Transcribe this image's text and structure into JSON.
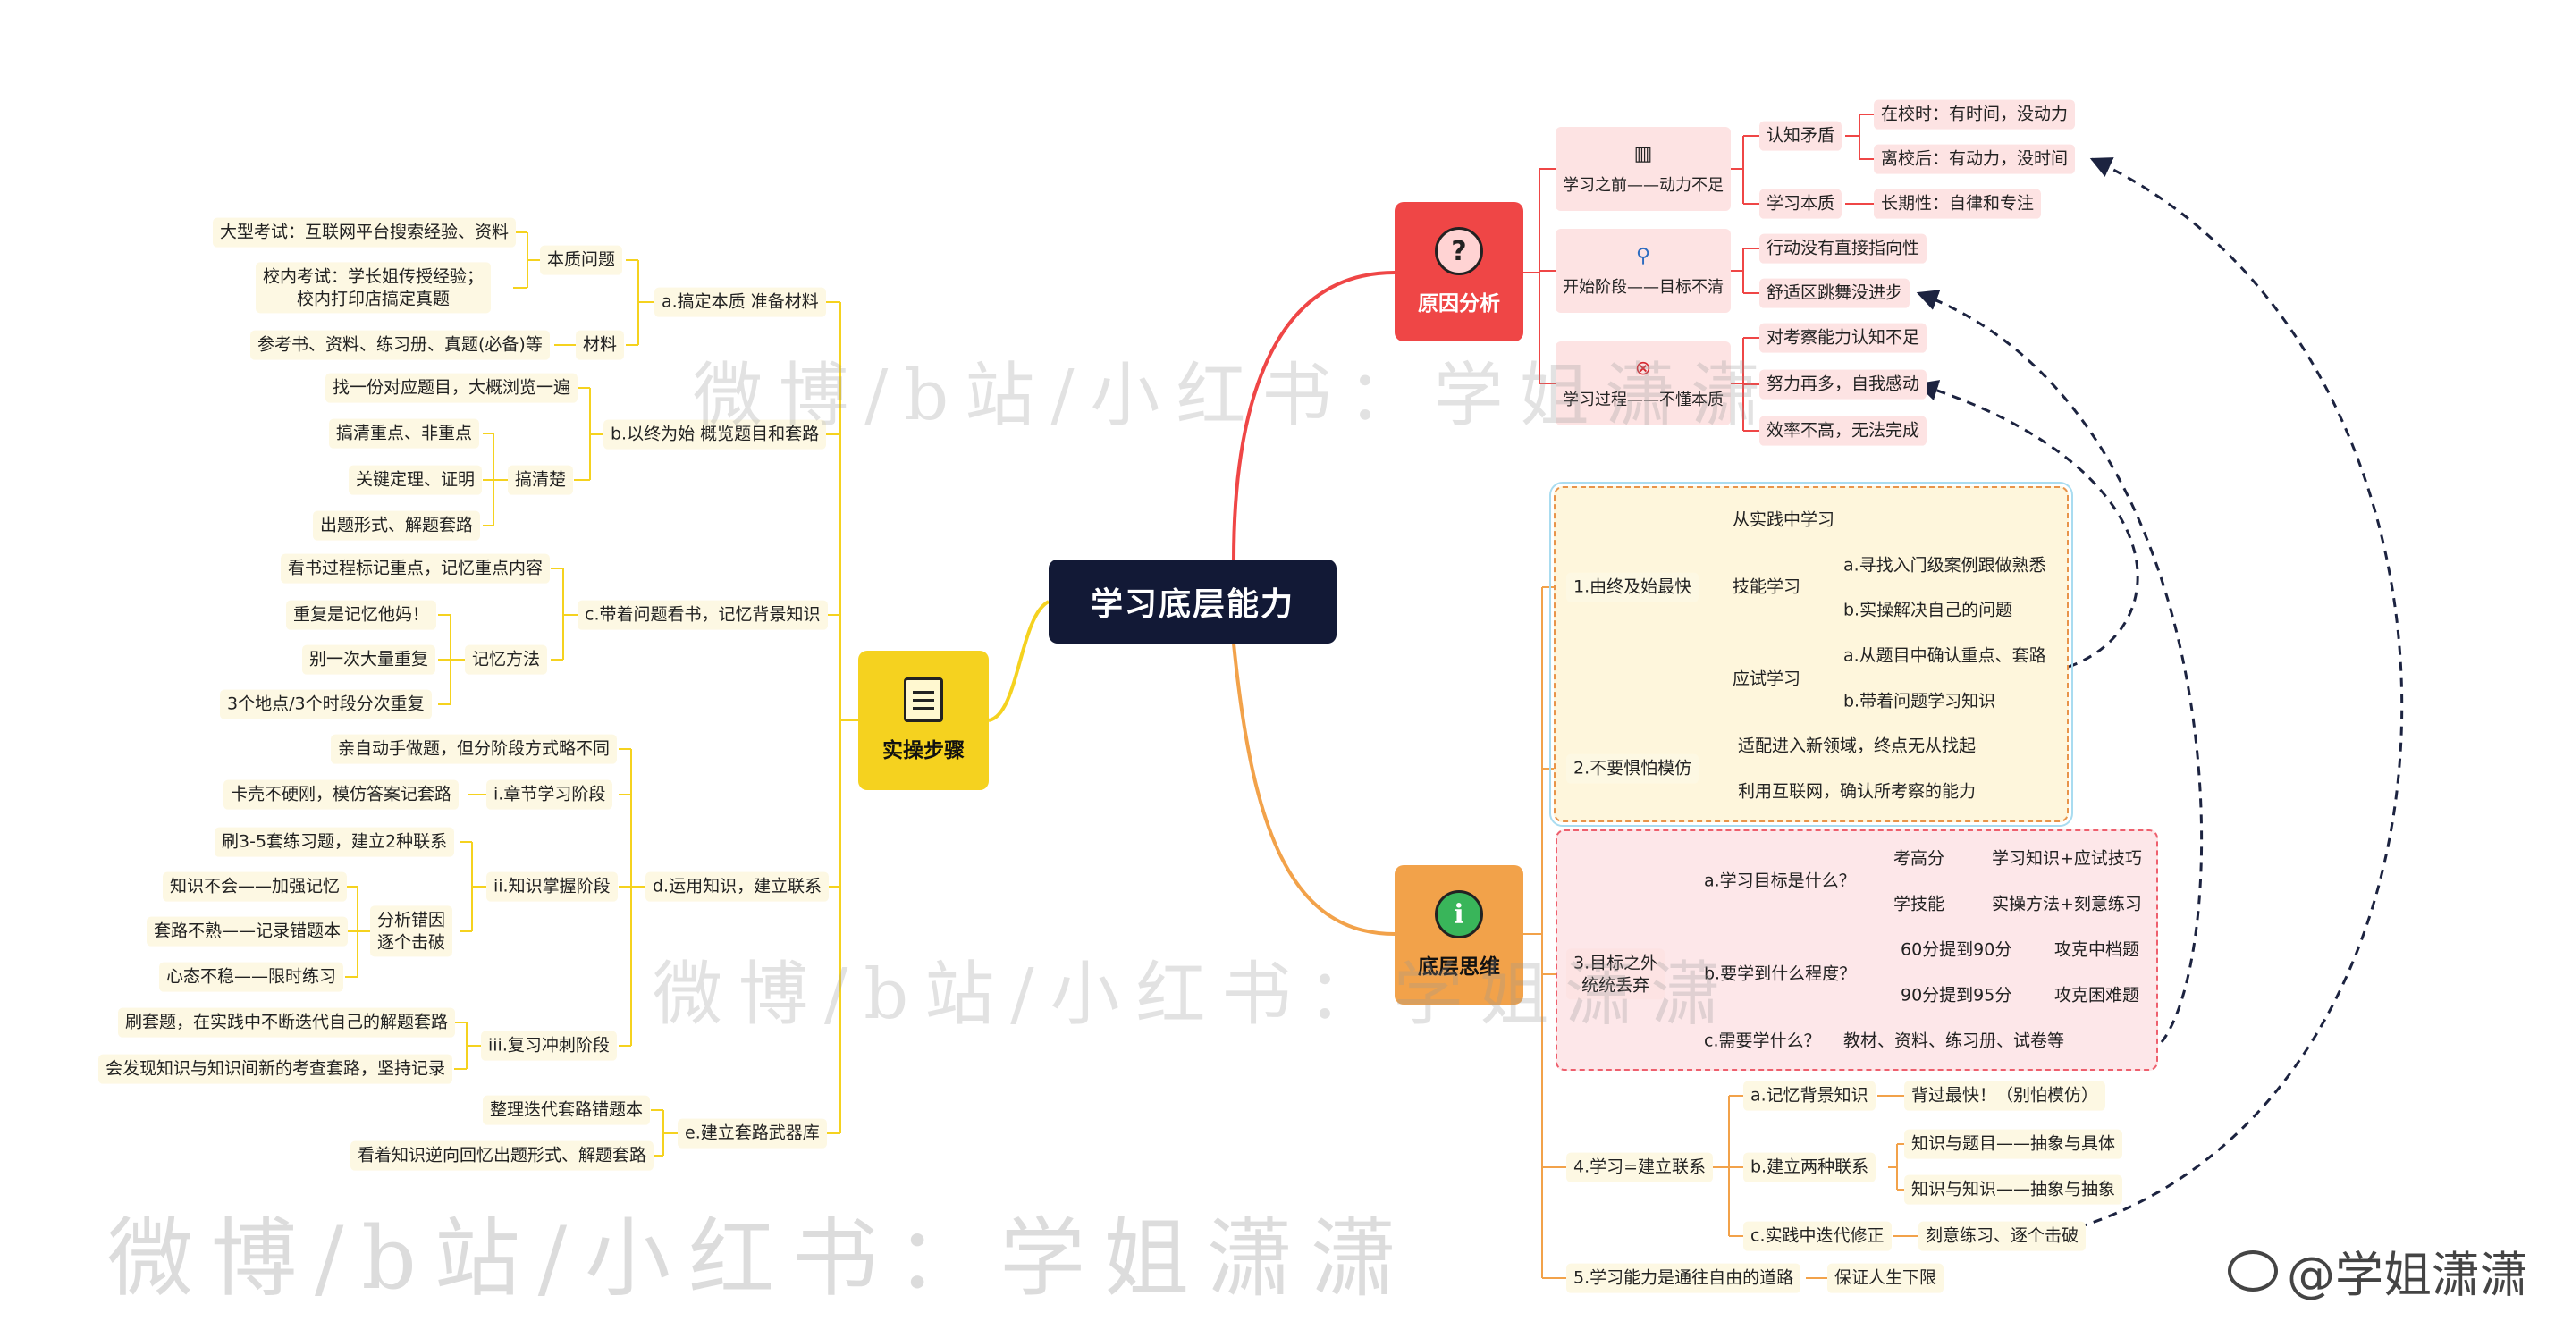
{
  "root": {
    "label": "学习底层能力"
  },
  "colors": {
    "root": "#121936",
    "cause": "#ef4646",
    "thinking": "#f2a24a",
    "steps": "#f5d21f",
    "light_red": "#fde3e3",
    "light_yellow": "#fdf8e3"
  },
  "cause": {
    "label": "原因分析",
    "icon": "question-icon",
    "before": {
      "label": "学习之前——动力不足",
      "icon": "bar-chart-icon",
      "cognitive": {
        "label": "认知矛盾",
        "school": "在校时：有时间，没动力",
        "off_school": "离校后：有动力，没时间"
      },
      "essence": {
        "label": "学习本质",
        "long_term": "长期性：自律和专注"
      }
    },
    "start": {
      "label": "开始阶段——目标不清",
      "icon": "magnifier-icon",
      "no_direction": "行动没有直接指向性",
      "comfort_zone": "舒适区跳舞没进步"
    },
    "process": {
      "label": "学习过程——不懂本质",
      "icon": "close-icon",
      "unaware": "对考察能力认知不足",
      "self_moved": "努力再多，自我感动",
      "low_efficiency": "效率不高，无法完成"
    }
  },
  "thinking": {
    "label": "底层思维",
    "icon": "info-icon",
    "p1": {
      "label": "1.由终及始最快",
      "practice": "从实践中学习",
      "skill": {
        "label": "技能学习",
        "a": "a.寻找入门级案例跟做熟悉",
        "b": "b.实操解决自己的问题"
      },
      "exam": {
        "label": "应试学习",
        "a": "a.从题目中确认重点、套路",
        "b": "b.带着问题学习知识"
      }
    },
    "p2": {
      "label": "2.不要惧怕模仿",
      "new_field": "适配进入新领域，终点无从找起",
      "internet": "利用互联网，确认所考察的能力"
    },
    "p3": {
      "label": "3.目标之外\n统统丢弃",
      "goal": {
        "label": "a.学习目标是什么？",
        "high_score": "考高分",
        "high_score_v": "学习知识+应试技巧",
        "learn_skill": "学技能",
        "learn_skill_v": "实操方法+刻意练习"
      },
      "degree": {
        "label": "b.要学到什么程度？",
        "to90": "60分提到90分",
        "to90_v": "攻克中档题",
        "to95": "90分提到95分",
        "to95_v": "攻克困难题"
      },
      "what": {
        "label": "c.需要学什么？",
        "what_v": "教材、资料、练习册、试卷等"
      }
    },
    "p4": {
      "label": "4.学习=建立联系",
      "a": {
        "label": "a.记忆背景知识",
        "v": "背过最快！（别怕模仿）"
      },
      "b": {
        "label": "b.建立两种联系",
        "v1": "知识与题目——抽象与具体",
        "v2": "知识与知识——抽象与抽象"
      },
      "c": {
        "label": "c.实践中迭代修正",
        "v": "刻意练习、逐个击破"
      }
    },
    "p5": {
      "label": "5.学习能力是通往自由的道路",
      "v": "保证人生下限"
    }
  },
  "steps": {
    "label": "实操步骤",
    "icon": "document-icon",
    "a": {
      "label": "a.搞定本质 准备材料",
      "essence": {
        "label": "本质问题",
        "big_exam": "大型考试：互联网平台搜索经验、资料",
        "campus_exam": "校内考试：学长姐传授经验；\n校内打印店搞定真题"
      },
      "material": {
        "label": "材料",
        "v": "参考书、资料、练习册、真题(必备)等"
      }
    },
    "b": {
      "label": "b.以终为始 概览题目和套路",
      "find": "找一份对应题目，大概浏览一遍",
      "clarify": {
        "label": "搞清楚",
        "key": "搞清重点、非重点",
        "theorem": "关键定理、证明",
        "form": "出题形式、解题套路"
      }
    },
    "c": {
      "label": "c.带着问题看书，记忆背景知识",
      "mark": "看书过程标记重点，记忆重点内容",
      "memory": {
        "label": "记忆方法",
        "m1": "重复是记忆他妈！",
        "m2": "别一次大量重复",
        "m3": "3个地点/3个时段分次重复"
      }
    },
    "d": {
      "label": "d.运用知识，建立联系",
      "hands_on": "亲自动手做题，但分阶段方式略不同",
      "i": {
        "label": "i.章节学习阶段",
        "v": "卡壳不硬刚，模仿答案记套路"
      },
      "ii": {
        "label": "ii.知识掌握阶段",
        "practice": "刷3-5套练习题，建立2种联系",
        "analyze": {
          "label": "分析错因\n逐个击破",
          "e1": "知识不会——加强记忆",
          "e2": "套路不熟——记录错题本",
          "e3": "心态不稳——限时练习"
        }
      },
      "iii": {
        "label": "iii.复习冲刺阶段",
        "v1": "刷套题，在实践中不断迭代自己的解题套路",
        "v2": "会发现知识与知识间新的考查套路，坚持记录"
      }
    },
    "e": {
      "label": "e.建立套路武器库",
      "v1": "整理迭代套路错题本",
      "v2": "看着知识逆向回忆出题形式、解题套路"
    }
  },
  "watermark": {
    "text1": "微博/b站/小红书：学姐潇潇",
    "text2": "微博/b站/小红书：学姐潇潇",
    "text3": "微博/b站/小红书：学姐潇潇"
  },
  "signature": "@学姐潇潇"
}
